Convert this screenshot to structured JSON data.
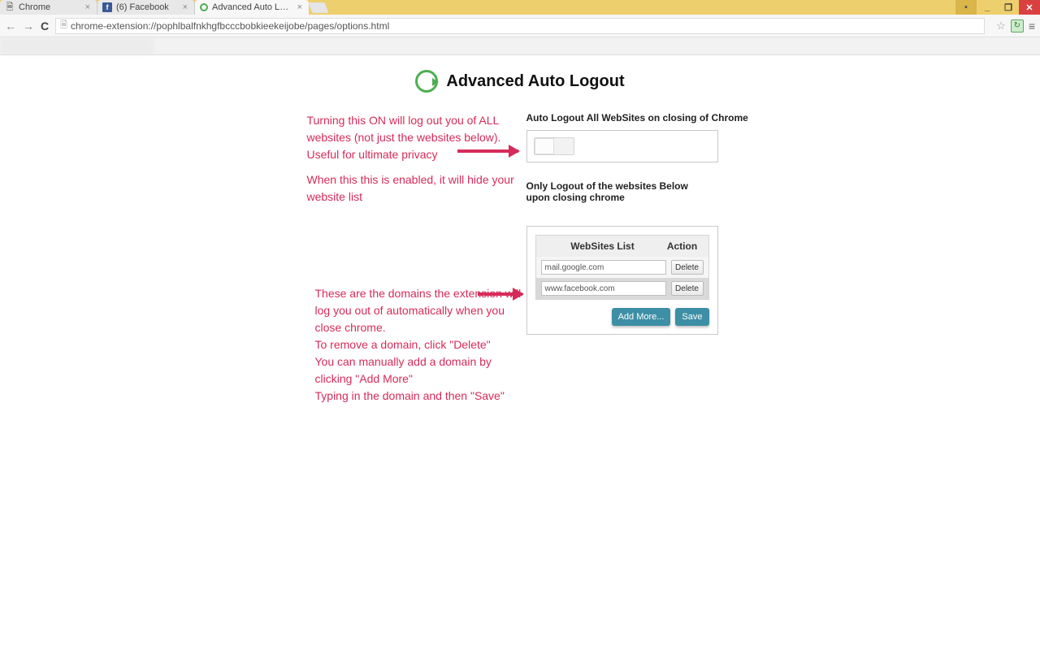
{
  "tabs": [
    {
      "title": "Chrome"
    },
    {
      "title": "(6) Facebook"
    },
    {
      "title": "Advanced Auto Logo"
    }
  ],
  "addressbar": {
    "url": "chrome-extension://pophlbalfnkhgfbcccbobkieekeijobe/pages/options.html"
  },
  "header": {
    "title": "Advanced Auto Logout"
  },
  "annotations": {
    "top1": "Turning this ON will log out you of ALL websites (not just the websites below). Useful for ultimate privacy",
    "top2": "When this this is enabled, it will hide your website list",
    "b1": "These are the domains the extension will",
    "b2": "log you out of automatically when you close chrome.",
    "b3": "To remove a domain, click \"Delete\"",
    "b4": "You can manually add a domain by clicking \"Add More\"",
    "b5": "Typing in the domain and then \"Save\""
  },
  "settings": {
    "all_label": "Auto Logout All WebSites on closing of Chrome",
    "list_label": "Only Logout of the websites Below upon closing chrome",
    "table": {
      "col_site": "WebSites List",
      "col_action": "Action",
      "rows": [
        {
          "domain": "mail.google.com",
          "action": "Delete"
        },
        {
          "domain": "www.facebook.com",
          "action": "Delete"
        }
      ]
    },
    "add_more": "Add More...",
    "save": "Save"
  }
}
